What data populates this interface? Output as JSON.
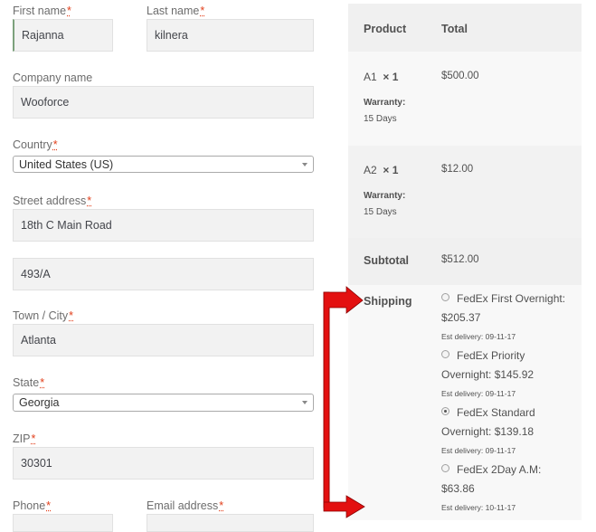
{
  "billing": {
    "first_name_label": "First name",
    "first_name_value": "Rajanna",
    "last_name_label": "Last name",
    "last_name_value": "kilnera",
    "company_label": "Company name",
    "company_value": "Wooforce",
    "country_label": "Country",
    "country_value": "United States (US)",
    "street_label": "Street address",
    "street_line1": "18th C Main Road",
    "street_line2": "493/A",
    "city_label": "Town / City",
    "city_value": "Atlanta",
    "state_label": "State",
    "state_value": "Georgia",
    "zip_label": "ZIP",
    "zip_value": "30301",
    "phone_label": "Phone",
    "email_label": "Email address",
    "required_mark": "*"
  },
  "order": {
    "col_product": "Product",
    "col_total": "Total",
    "items": [
      {
        "name": "A1",
        "qty": "× 1",
        "price": "$500.00",
        "meta_label": "Warranty:",
        "meta_value": "15 Days"
      },
      {
        "name": "A2",
        "qty": "× 1",
        "price": "$12.00",
        "meta_label": "Warranty:",
        "meta_value": "15 Days"
      }
    ],
    "subtotal_label": "Subtotal",
    "subtotal_value": "$512.00",
    "shipping_label": "Shipping",
    "shipping_options": [
      {
        "line1": "FedEx First Overnight:",
        "line2": "$205.37",
        "delivery": "Est delivery: 09-11-17",
        "selected": false
      },
      {
        "line1": "FedEx Priority",
        "line2": "Overnight: $145.92",
        "delivery": "Est delivery: 09-11-17",
        "selected": false
      },
      {
        "line1": "FedEx Standard",
        "line2": "Overnight: $139.18",
        "delivery": "Est delivery: 09-11-17",
        "selected": true
      },
      {
        "line1": "FedEx 2Day A.M:",
        "line2": "$63.86",
        "delivery": "Est delivery: 10-11-17",
        "selected": false
      }
    ]
  },
  "colors": {
    "arrow": "#e31010",
    "required": "#e2401c",
    "input_bg": "#f2f2f2",
    "panel_bg": "#f8f8f8"
  }
}
